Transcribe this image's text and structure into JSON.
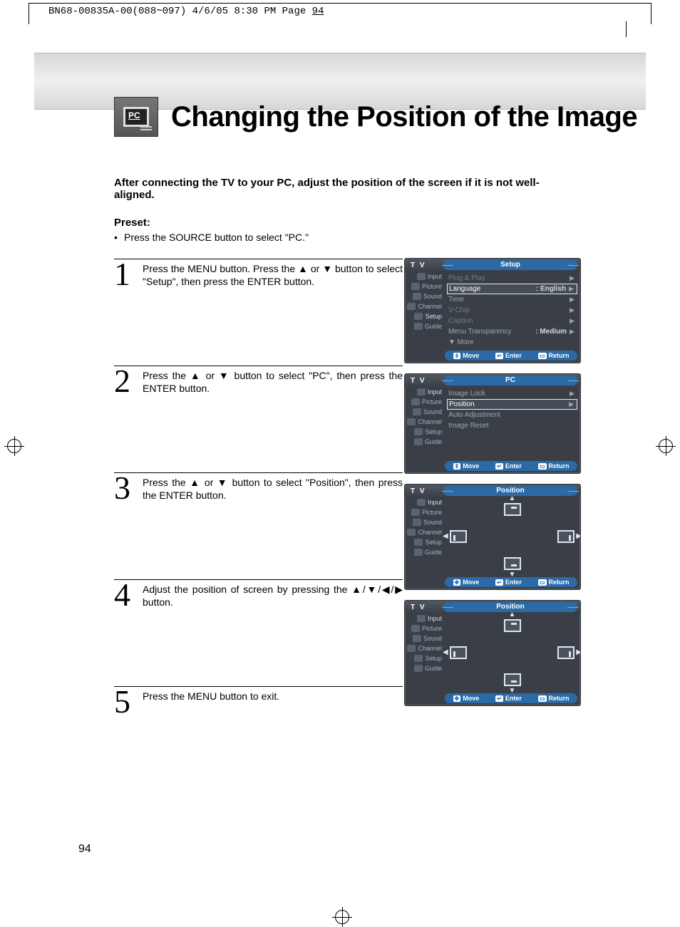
{
  "slug_prefix": "BN68-00835A-00(088~097)  4/6/05  8:30 PM  Page ",
  "slug_page": "94",
  "page_number": "94",
  "icon_label": "PC",
  "title": "Changing the Position of the Image",
  "intro": "After connecting the TV to your PC, adjust the position of the screen if it is not well-aligned.",
  "preset_heading": "Preset:",
  "preset_item": "Press the SOURCE button to select \"PC.\"",
  "steps": {
    "s1": {
      "num": "1",
      "text": "Press the MENU button. Press the ▲ or ▼ button to select \"Setup\", then press the ENTER button."
    },
    "s2": {
      "num": "2",
      "text": "Press the ▲ or ▼ button to select \"PC\", then press the ENTER button."
    },
    "s3": {
      "num": "3",
      "text": "Press the ▲ or ▼ button to select \"Position\", then press the ENTER button."
    },
    "s4": {
      "num": "4",
      "text": "Adjust the position of screen by pressing the ▲/▼/◀/▶ button."
    },
    "s5": {
      "num": "5",
      "text": "Press the MENU button to exit."
    }
  },
  "osd_common": {
    "tv": "T V",
    "side": {
      "input": "Input",
      "picture": "Picture",
      "sound": "Sound",
      "channel": "Channel",
      "setup": "Setup",
      "guide": "Guide"
    },
    "foot_move_ud": "Move",
    "foot_move_all": "Move",
    "foot_enter": "Enter",
    "foot_return": "Return",
    "foot_icon_ud": "⇕",
    "foot_icon_all": "✥",
    "foot_icon_enter": "↵",
    "foot_icon_return": "▭"
  },
  "osd1": {
    "title": "Setup",
    "rows": {
      "r1": {
        "lab": "Plug & Play"
      },
      "r2": {
        "lab": "Language",
        "val": ": English"
      },
      "r3": {
        "lab": "Time"
      },
      "r4": {
        "lab": "V-Chip"
      },
      "r5": {
        "lab": "Caption"
      },
      "r6": {
        "lab": "Menu Transparency",
        "val": ": Medium"
      },
      "r7": {
        "lab": "▼ More"
      }
    }
  },
  "osd2": {
    "title": "PC",
    "rows": {
      "r1": {
        "lab": "Image Lock"
      },
      "r2": {
        "lab": "Position"
      },
      "r3": {
        "lab": "Auto Adjustment"
      },
      "r4": {
        "lab": "Image Reset"
      }
    }
  },
  "osd3": {
    "title": "Position"
  },
  "osd4": {
    "title": "Position"
  }
}
